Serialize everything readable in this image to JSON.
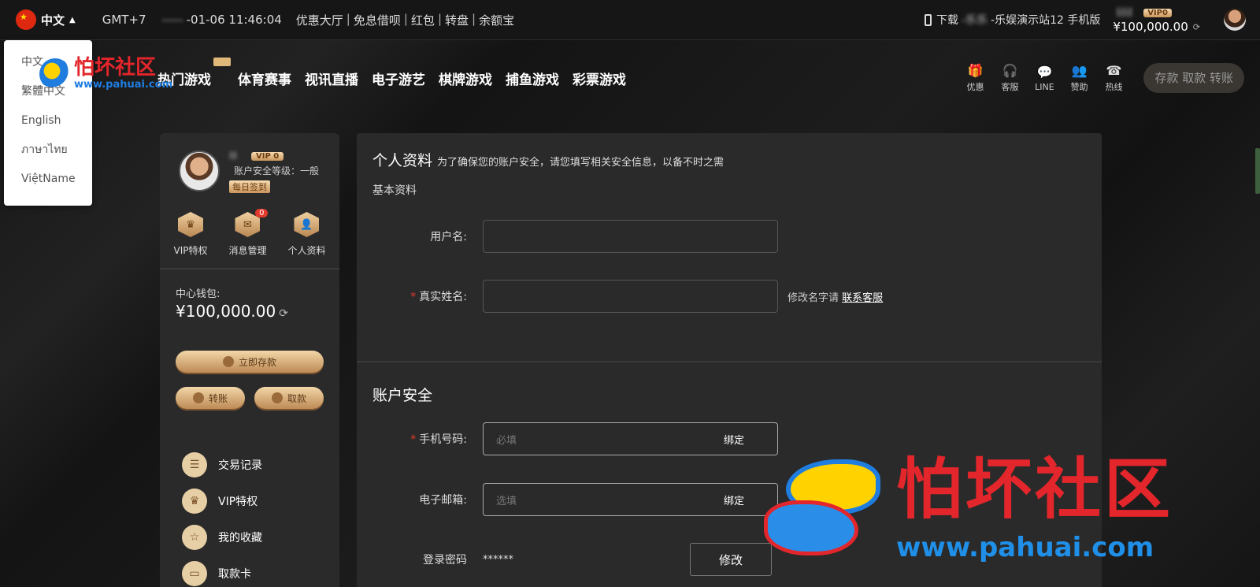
{
  "topbar": {
    "language": "中文",
    "timezone": "GMT+7",
    "time_prefix": "-----",
    "time": "-01-06 11:46:04",
    "links": [
      "优惠大厅",
      "免息借呗",
      "红包",
      "转盘",
      "余额宝"
    ],
    "download_label": "下载",
    "site_name_blurred": "-乐乐",
    "site_name": "-乐娱演示站12 手机版",
    "username_blurred": "lilil",
    "vip_label": "VIP0",
    "balance": "¥100,000.00",
    "refresh_icon": "refresh-icon"
  },
  "language_menu": [
    "中文",
    "繁體中文",
    "English",
    "ภาษาไทย",
    "ViệtName"
  ],
  "nav": {
    "items": [
      "热门游戏",
      "体育赛事",
      "视讯直播",
      "电子游艺",
      "棋牌游戏",
      "捕鱼游戏",
      "彩票游戏"
    ],
    "icons": [
      {
        "label": "优惠",
        "icon": "gift-icon",
        "glyph": "🎁"
      },
      {
        "label": "客服",
        "icon": "headset-icon",
        "glyph": "🎧"
      },
      {
        "label": "LINE",
        "icon": "line-icon",
        "glyph": "💬"
      },
      {
        "label": "赞助",
        "icon": "people-icon",
        "glyph": "👥"
      },
      {
        "label": "热线",
        "icon": "phone-icon",
        "glyph": "☎"
      }
    ],
    "deposit_button": "存款 取款 转账"
  },
  "watermark": {
    "text": "怕坏社区",
    "url": "www.pahuai.com"
  },
  "sidebar": {
    "username_blurred": "lll",
    "vip_label": "VIP 0",
    "security_level": "账户安全等级：一般",
    "daily_checkin": "每日签到",
    "shortcuts": [
      {
        "label": "VIP特权",
        "icon": "crown-icon"
      },
      {
        "label": "消息管理",
        "icon": "message-icon",
        "count": "0"
      },
      {
        "label": "个人资料",
        "icon": "user-icon"
      }
    ],
    "wallet_label": "中心钱包:",
    "wallet_amount": "¥100,000.00",
    "deposit_now": "立即存款",
    "transfer": "转账",
    "withdraw": "取款",
    "menu": [
      {
        "label": "交易记录",
        "icon": "document-icon"
      },
      {
        "label": "VIP特权",
        "icon": "crown-icon"
      },
      {
        "label": "我的收藏",
        "icon": "star-icon"
      },
      {
        "label": "取款卡",
        "icon": "card-icon"
      }
    ]
  },
  "main": {
    "title": "个人资料",
    "subtitle": "为了确保您的账户安全，请您填写相关安全信息，以备不时之需",
    "basic_section": "基本资料",
    "username_label": "用户名:",
    "realname_label": "真实姓名:",
    "realname_note": "修改名字请",
    "contact_service": "联系客服",
    "security_section": "账户安全",
    "phone_label": "手机号码:",
    "phone_placeholder": "必填",
    "bind_label": "绑定",
    "email_label": "电子邮箱:",
    "email_placeholder": "选填",
    "password_label": "登录密码",
    "password_value": "******",
    "modify_button": "修改"
  }
}
